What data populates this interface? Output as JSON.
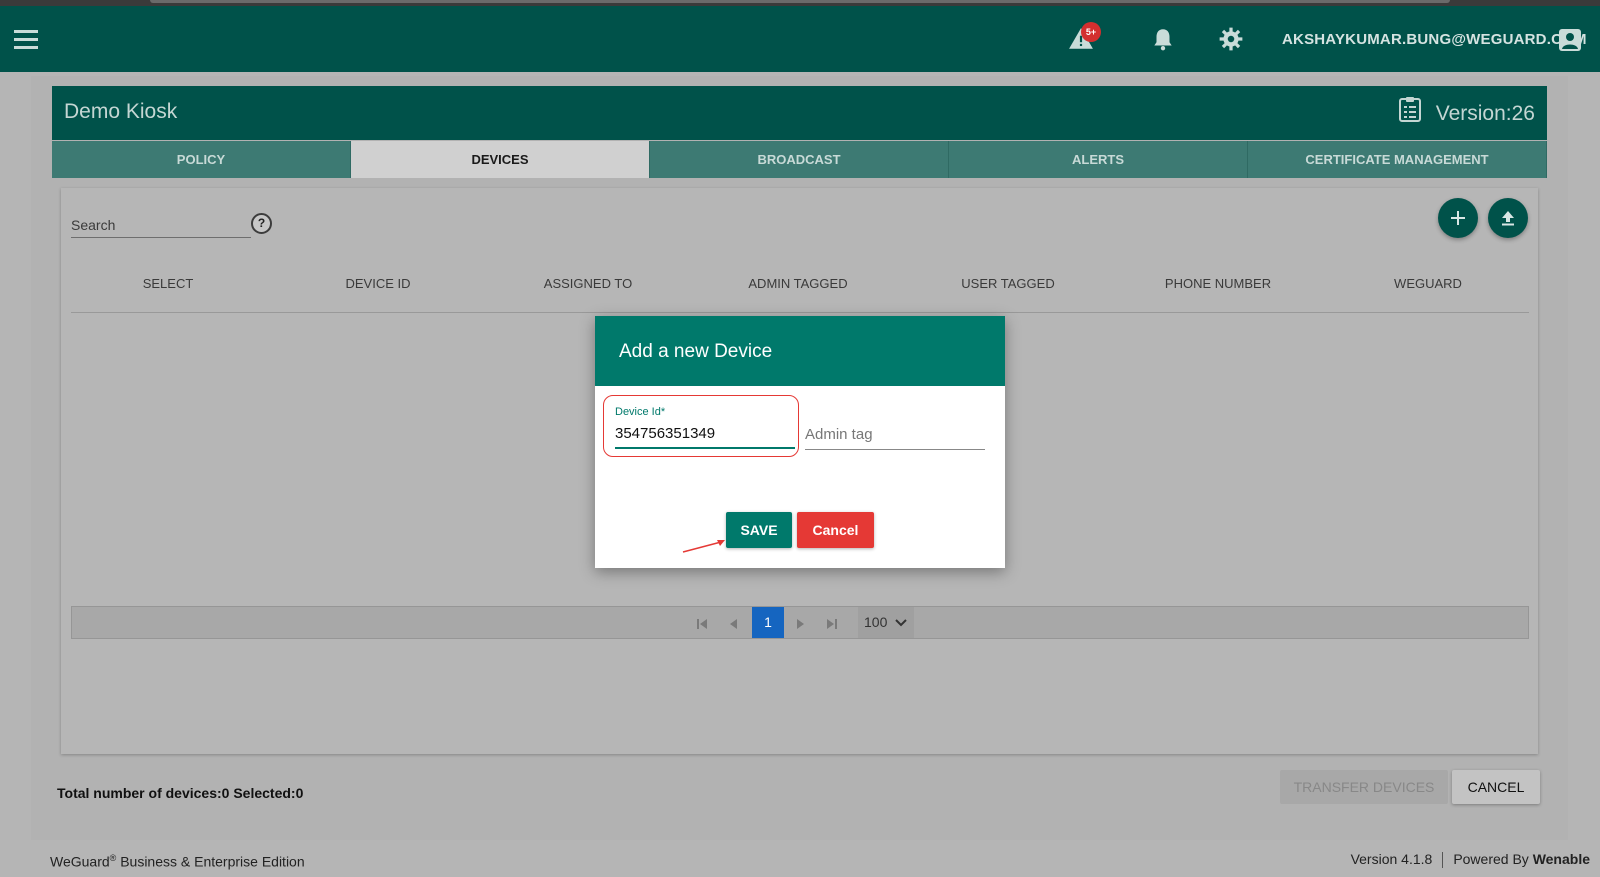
{
  "topbar": {
    "alert_badge": "5+",
    "user_email": "AKSHAYKUMAR.BUNG@WEGUARD.COM"
  },
  "header": {
    "title": "Demo Kiosk",
    "version": "Version:26"
  },
  "tabs": [
    {
      "label": "POLICY"
    },
    {
      "label": "DEVICES"
    },
    {
      "label": "BROADCAST"
    },
    {
      "label": "ALERTS"
    },
    {
      "label": "CERTIFICATE MANAGEMENT"
    }
  ],
  "search": {
    "placeholder": "Search",
    "help": "?"
  },
  "table": {
    "columns": [
      "SELECT",
      "DEVICE ID",
      "ASSIGNED TO",
      "ADMIN TAGGED",
      "USER TAGGED",
      "PHONE NUMBER",
      "WEGUARD"
    ]
  },
  "pager": {
    "current_page": "1",
    "page_size": "100"
  },
  "totals": "Total number of devices:0  Selected:0",
  "actions": {
    "transfer": "TRANSFER DEVICES",
    "cancel": "CANCEL"
  },
  "modal": {
    "title": "Add a new Device",
    "device_id_label": "Device Id*",
    "device_id_value": "354756351349",
    "admin_tag_placeholder": "Admin tag",
    "save": "SAVE",
    "cancel": "Cancel"
  },
  "footer": {
    "brand": "WeGuard",
    "reg": "®",
    "edition": " Business & Enterprise Edition",
    "version": "Version 4.1.8",
    "powered_prefix": "Powered By ",
    "powered_brand": "Wenable"
  },
  "colors": {
    "primary": "#00524a",
    "dialog_header": "#00796b",
    "danger": "#e53935",
    "page_active": "#1565c0"
  }
}
